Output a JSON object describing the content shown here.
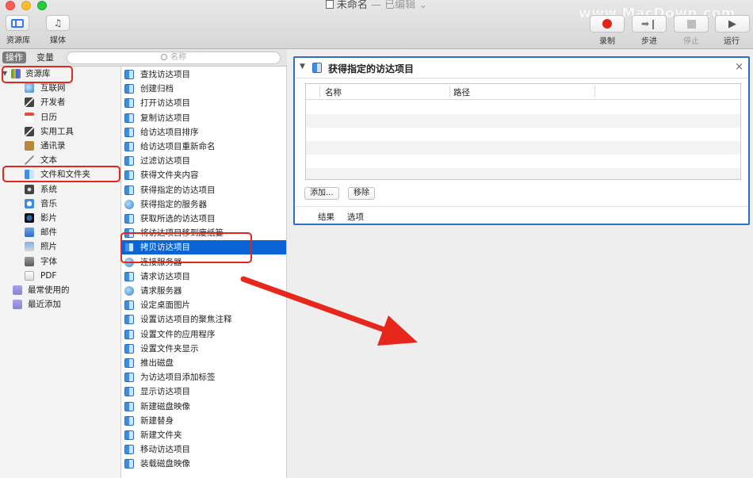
{
  "window": {
    "title": "未命名",
    "title_suffix": "— 已编辑 ⌄",
    "watermark": "www.MacDown.com"
  },
  "toolbar": {
    "library_label": "资源库",
    "media_label": "媒体",
    "record_label": "录制",
    "step_label": "步进",
    "stop_label": "停止",
    "run_label": "运行",
    "record_color": "#e2231a"
  },
  "left_header": {
    "actions_tab": "操作",
    "variables_tab": "变量",
    "search_placeholder": "名称"
  },
  "library": {
    "root": "资源库",
    "items": [
      {
        "label": "互联网",
        "icon": "globe-icon"
      },
      {
        "label": "开发者",
        "icon": "tools-icon"
      },
      {
        "label": "日历",
        "icon": "calendar-icon"
      },
      {
        "label": "实用工具",
        "icon": "tools-icon"
      },
      {
        "label": "通讯录",
        "icon": "contacts-icon"
      },
      {
        "label": "文本",
        "icon": "text-icon"
      },
      {
        "label": "文件和文件夹",
        "icon": "finder-icon"
      },
      {
        "label": "系统",
        "icon": "camera-icon"
      },
      {
        "label": "音乐",
        "icon": "music-icon"
      },
      {
        "label": "影片",
        "icon": "movie-icon"
      },
      {
        "label": "邮件",
        "icon": "mail-icon"
      },
      {
        "label": "照片",
        "icon": "photos-icon"
      },
      {
        "label": "字体",
        "icon": "font-icon"
      },
      {
        "label": "PDF",
        "icon": "pdf-icon"
      }
    ],
    "smart_groups": [
      {
        "label": "最常使用的",
        "icon": "folder-icon"
      },
      {
        "label": "最近添加",
        "icon": "folder-icon"
      }
    ]
  },
  "actions": {
    "items": [
      {
        "label": "查找访达项目",
        "icon": "finder-icon"
      },
      {
        "label": "创建归档",
        "icon": "finder-icon"
      },
      {
        "label": "打开访达项目",
        "icon": "finder-icon"
      },
      {
        "label": "复制访达项目",
        "icon": "finder-icon"
      },
      {
        "label": "给访达项目排序",
        "icon": "finder-icon"
      },
      {
        "label": "给访达项目重新命名",
        "icon": "finder-icon"
      },
      {
        "label": "过滤访达项目",
        "icon": "finder-icon"
      },
      {
        "label": "获得文件夹内容",
        "icon": "finder-icon"
      },
      {
        "label": "获得指定的访达项目",
        "icon": "finder-icon"
      },
      {
        "label": "获得指定的服务器",
        "icon": "globe-icon"
      },
      {
        "label": "获取所选的访达项目",
        "icon": "finder-icon"
      },
      {
        "label": "将访达项目移到废纸篓",
        "icon": "finder-icon"
      },
      {
        "label": "拷贝访达项目",
        "icon": "finder-icon"
      },
      {
        "label": "连接服务器",
        "icon": "globe-icon"
      },
      {
        "label": "请求访达项目",
        "icon": "finder-icon"
      },
      {
        "label": "请求服务器",
        "icon": "globe-icon"
      },
      {
        "label": "设定桌面图片",
        "icon": "finder-icon"
      },
      {
        "label": "设置访达项目的聚焦注释",
        "icon": "finder-icon"
      },
      {
        "label": "设置文件的应用程序",
        "icon": "finder-icon"
      },
      {
        "label": "设置文件夹显示",
        "icon": "finder-icon"
      },
      {
        "label": "推出磁盘",
        "icon": "finder-icon"
      },
      {
        "label": "为访达项目添加标签",
        "icon": "finder-icon"
      },
      {
        "label": "显示访达项目",
        "icon": "finder-icon"
      },
      {
        "label": "新建磁盘映像",
        "icon": "finder-icon"
      },
      {
        "label": "新建替身",
        "icon": "finder-icon"
      },
      {
        "label": "新建文件夹",
        "icon": "finder-icon"
      },
      {
        "label": "移动访达项目",
        "icon": "finder-icon"
      },
      {
        "label": "装载磁盘映像",
        "icon": "finder-icon"
      }
    ],
    "selected_index": 12
  },
  "action_card": {
    "title": "获得指定的访达项目",
    "close": "×",
    "columns": [
      "名称",
      "路径"
    ],
    "add_button": "添加...",
    "remove_button": "移除",
    "footer_tabs": [
      "结果",
      "选项"
    ],
    "accent_color": "#2c6fc4"
  },
  "annotation": {
    "highlight_color": "#e0281e"
  }
}
